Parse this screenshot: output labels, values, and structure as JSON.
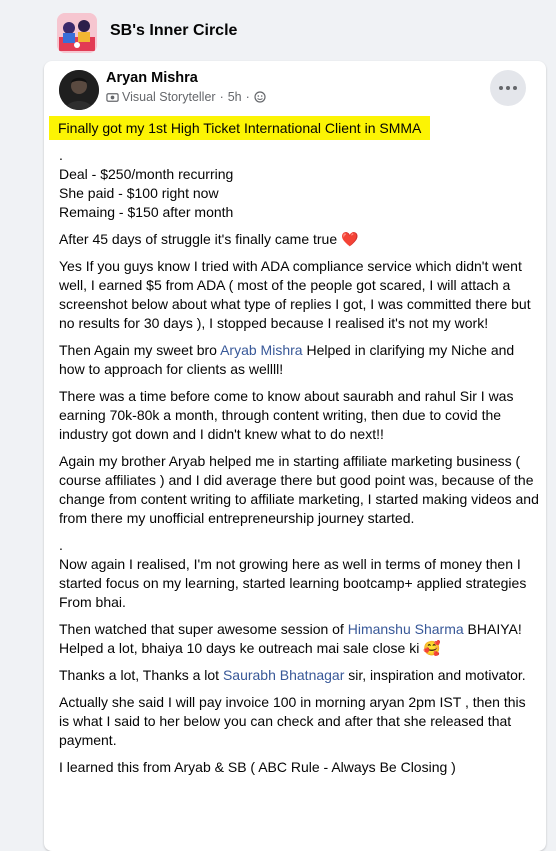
{
  "group": {
    "name": "SB's Inner Circle"
  },
  "post": {
    "author": "Aryan Mishra",
    "badge": "Visual Storyteller",
    "time": "5h",
    "headline": "Finally got my 1st High Ticket International Client in SMMA",
    "dot1": ".",
    "deal_line1": "Deal - $250/month recurring",
    "deal_line2": "She paid - $100 right now",
    "deal_line3": "Remaing - $150 after month",
    "struggle": "After 45 days of struggle it's finally came true",
    "heart": "❤️",
    "ada_paragraph": "Yes If you guys know I tried with ADA compliance service which didn't went well, I earned $5 from ADA ( most of the people got scared, I will attach a screenshot below about what type of replies I got, I was committed there but no results for 30 days ), I stopped because I realised it's not my work!",
    "then_prefix": "Then Again my sweet bro ",
    "then_link": "Aryab Mishra",
    "then_suffix": " Helped in clarifying my Niche and how to approach for clients as wellll!",
    "time_paragraph": "There was a time before come to know about saurabh and rahul Sir I was earning 70k-80k a month, through content writing, then due to covid the industry got down and I didn't knew what to do next!!",
    "affiliate_paragraph": "Again my brother Aryab helped me in starting affiliate marketing business ( course affiliates ) and I did average there but good point was, because of the change from content writing to affiliate marketing, I started making videos and from there my unofficial entrepreneurship journey started.",
    "dot2": ".",
    "realised_paragraph": "Now again I realised, I'm not growing here as well in terms of money then I started focus on my learning, started learning bootcamp+ applied strategies From bhai.",
    "watched_prefix": "Then watched that super awesome session of ",
    "watched_link": "Himanshu Sharma",
    "watched_suffix": " BHAIYA! Helped a lot, bhaiya 10 days ke outreach mai sale close ki",
    "watched_emoji": "🥰",
    "thanks_prefix": "Thanks a lot, Thanks a lot ",
    "thanks_link": "Saurabh Bhatnagar",
    "thanks_suffix": "  sir, inspiration and motivator.",
    "invoice_paragraph": "Actually she said I will pay invoice 100  in morning aryan 2pm IST , then this is what I said to her below you can check and after that she released that payment.",
    "learned_paragraph": "I learned this from Aryab & SB ( ABC Rule - Always Be Closing )"
  }
}
